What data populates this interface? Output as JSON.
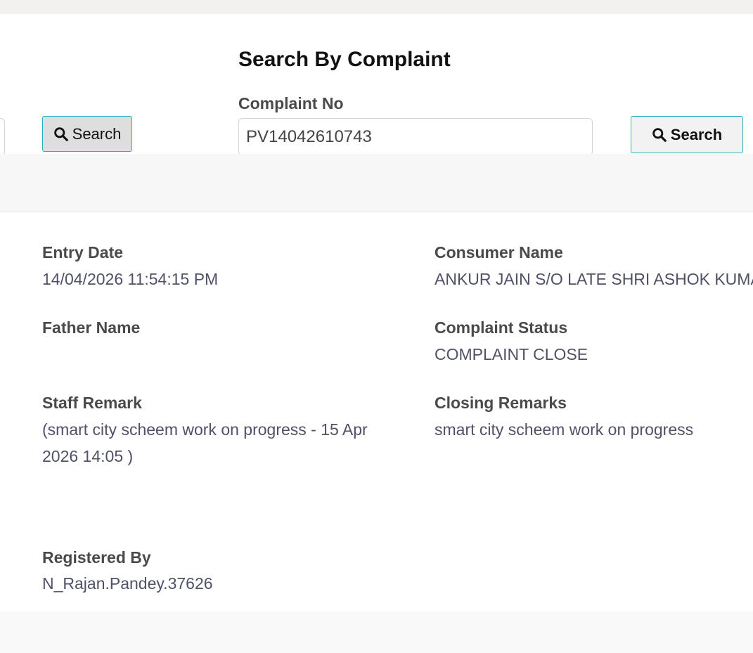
{
  "search_left": {
    "button_label": "Search"
  },
  "search_complaint": {
    "title": "Search By Complaint",
    "field_label": "Complaint No",
    "value": "PV14042610743",
    "button_label": "Search"
  },
  "details": {
    "entry_date": {
      "label": "Entry Date",
      "value": "14/04/2026 11:54:15 PM"
    },
    "consumer_name": {
      "label": "Consumer Name",
      "value": "ANKUR JAIN S/O LATE SHRI ASHOK KUMAR JAIN"
    },
    "father_name": {
      "label": "Father Name",
      "value": ""
    },
    "complaint_status": {
      "label": "Complaint Status",
      "value": "COMPLAINT CLOSE"
    },
    "staff_remark": {
      "label": "Staff Remark",
      "value": "(smart city scheem work on progress - 15 Apr 2026 14:05 )"
    },
    "closing_remarks": {
      "label": "Closing Remarks",
      "value": "smart city scheem work on progress"
    },
    "registered_by": {
      "label": "Registered By",
      "value": "N_Rajan.Pandey.37626"
    }
  },
  "icons": {
    "search": "search-icon"
  },
  "colors": {
    "button_border": "#2bb1b7",
    "label": "#4a4a4a",
    "value": "#4f5266"
  }
}
